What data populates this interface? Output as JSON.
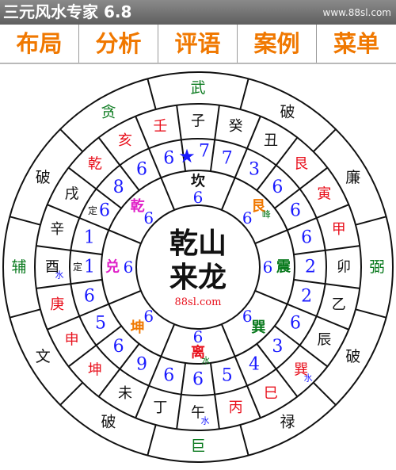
{
  "app": {
    "title": "三元风水专家 6.8",
    "site": "www.88sl.com"
  },
  "menu": [
    {
      "label": "布局"
    },
    {
      "label": "分析"
    },
    {
      "label": "评语"
    },
    {
      "label": "案例"
    },
    {
      "label": "菜单"
    }
  ],
  "center": {
    "line1": "乾山",
    "line2": "来龙",
    "site": "88sl.com"
  },
  "colors": {
    "black": "#111111",
    "blue": "#1a1aff",
    "red": "#e8101c",
    "orange": "#f07800",
    "green": "#0a7a1e",
    "magenta": "#e020c8",
    "orange_accent": "#f07800"
  },
  "rings": {
    "outer": [
      {
        "text": "武",
        "color": "green"
      },
      {
        "text": "破",
        "color": "black"
      },
      {
        "text": "廉",
        "color": "black"
      },
      {
        "text": "弼",
        "color": "green"
      },
      {
        "text": "破",
        "color": "black"
      },
      {
        "text": "禄",
        "color": "black"
      },
      {
        "text": "巨",
        "color": "green"
      },
      {
        "text": "破",
        "color": "black"
      },
      {
        "text": "文",
        "color": "black"
      },
      {
        "text": "辅",
        "color": "green"
      },
      {
        "text": "破",
        "color": "black"
      },
      {
        "text": "贪",
        "color": "green"
      }
    ],
    "mountains": [
      {
        "text": "子",
        "color": "black",
        "sub": ""
      },
      {
        "text": "癸",
        "color": "black",
        "sub": ""
      },
      {
        "text": "丑",
        "color": "black",
        "sub": ""
      },
      {
        "text": "艮",
        "color": "red",
        "sub": ""
      },
      {
        "text": "寅",
        "color": "red",
        "sub": ""
      },
      {
        "text": "甲",
        "color": "red",
        "sub": ""
      },
      {
        "text": "卯",
        "color": "black",
        "sub": ""
      },
      {
        "text": "乙",
        "color": "black",
        "sub": ""
      },
      {
        "text": "辰",
        "color": "black",
        "sub": ""
      },
      {
        "text": "巽",
        "color": "red",
        "sub": "水"
      },
      {
        "text": "巳",
        "color": "red",
        "sub": ""
      },
      {
        "text": "丙",
        "color": "red",
        "sub": ""
      },
      {
        "text": "午",
        "color": "black",
        "sub": "水"
      },
      {
        "text": "丁",
        "color": "black",
        "sub": ""
      },
      {
        "text": "未",
        "color": "black",
        "sub": ""
      },
      {
        "text": "坤",
        "color": "red",
        "sub": ""
      },
      {
        "text": "申",
        "color": "red",
        "sub": ""
      },
      {
        "text": "庚",
        "color": "red",
        "sub": ""
      },
      {
        "text": "酉",
        "color": "black",
        "sub": "水"
      },
      {
        "text": "辛",
        "color": "black",
        "sub": ""
      },
      {
        "text": "戌",
        "color": "black",
        "sub": ""
      },
      {
        "text": "乾",
        "color": "red",
        "sub": ""
      },
      {
        "text": "亥",
        "color": "red",
        "sub": ""
      },
      {
        "text": "壬",
        "color": "red",
        "sub": ""
      }
    ],
    "stars_outer": [
      {
        "text": "7",
        "mark": "star"
      },
      {
        "text": "7",
        "mark": ""
      },
      {
        "text": "3",
        "mark": ""
      },
      {
        "text": "6",
        "mark": ""
      },
      {
        "text": "6",
        "mark": ""
      },
      {
        "text": "6",
        "mark": ""
      },
      {
        "text": "2",
        "mark": ""
      },
      {
        "text": "2",
        "mark": ""
      },
      {
        "text": "6",
        "mark": ""
      },
      {
        "text": "3",
        "mark": ""
      },
      {
        "text": "4",
        "mark": ""
      },
      {
        "text": "5",
        "mark": ""
      },
      {
        "text": "6",
        "mark": ""
      },
      {
        "text": "6",
        "mark": ""
      },
      {
        "text": "9",
        "mark": ""
      },
      {
        "text": "6",
        "mark": ""
      },
      {
        "text": "5",
        "mark": ""
      },
      {
        "text": "6",
        "mark": ""
      },
      {
        "text": "1",
        "mark": "定"
      },
      {
        "text": "1",
        "mark": ""
      },
      {
        "text": "6",
        "mark": "定"
      },
      {
        "text": "8",
        "mark": ""
      },
      {
        "text": "6",
        "mark": ""
      },
      {
        "text": "6",
        "mark": ""
      }
    ],
    "trigrams": [
      {
        "text": "坎",
        "color": "black",
        "sub": ""
      },
      {
        "text": "艮",
        "color": "orange",
        "sub": "峰"
      },
      {
        "text": "震",
        "color": "green",
        "sub": ""
      },
      {
        "text": "巽",
        "color": "green",
        "sub": ""
      },
      {
        "text": "离",
        "color": "red",
        "sub": "水"
      },
      {
        "text": "坤",
        "color": "orange",
        "sub": ""
      },
      {
        "text": "兑",
        "color": "magenta",
        "sub": ""
      },
      {
        "text": "乾",
        "color": "magenta",
        "sub": ""
      }
    ],
    "trigram_stars": [
      "6",
      "6",
      "6",
      "6",
      "6",
      "6",
      "6",
      "6"
    ]
  }
}
